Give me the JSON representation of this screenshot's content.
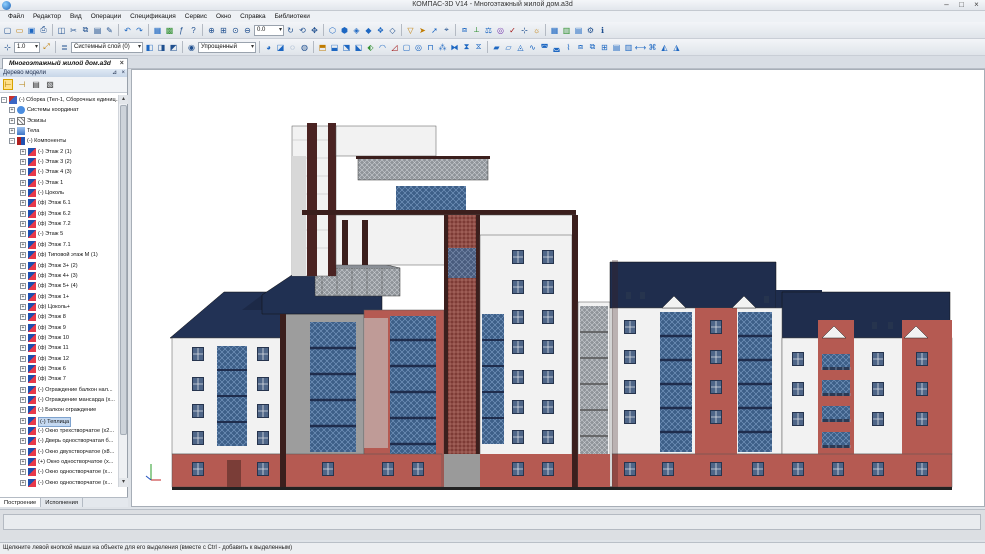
{
  "window": {
    "title": "КОМПАС-3D V14 - Многоэтажный жилой дом.a3d",
    "controls": [
      "minimize",
      "maximize",
      "close"
    ]
  },
  "menu": [
    "Файл",
    "Редактор",
    "Вид",
    "Операции",
    "Спецификация",
    "Сервис",
    "Окно",
    "Справка",
    "Библиотеки"
  ],
  "toolbar": {
    "scale_value": "0.0",
    "line_width": "1.0",
    "layer": "Системный слой (0)",
    "render_mode": "Упрощенный"
  },
  "document_tab": {
    "label": "Многоэтажный жилой дом.a3d"
  },
  "tree_panel": {
    "header": "Дерево модели",
    "root": "(-) Сборка (Тел-1, Сборочных единиц...",
    "items": [
      {
        "label": "Системы координат",
        "icon": "csys-icon",
        "level": 1
      },
      {
        "label": "Эскизы",
        "icon": "sketch-icon",
        "level": 1
      },
      {
        "label": "Тела",
        "icon": "body-icon",
        "level": 1
      },
      {
        "label": "(-) Компоненты",
        "icon": "components-icon",
        "level": 1
      },
      {
        "label": "(-) Этаж 2 (1)",
        "icon": "component-icon",
        "level": 2
      },
      {
        "label": "(-) Этаж 3 (2)",
        "icon": "component-icon",
        "level": 2
      },
      {
        "label": "(-) Этаж 4 (3)",
        "icon": "component-icon",
        "level": 2
      },
      {
        "label": "(-) Этаж 1",
        "icon": "component-icon",
        "level": 2
      },
      {
        "label": "(-) Цоколь",
        "icon": "component-icon",
        "level": 2
      },
      {
        "label": "(ф) Этаж 6.1",
        "icon": "component-icon",
        "level": 2
      },
      {
        "label": "(ф) Этаж 6.2",
        "icon": "component-icon",
        "level": 2
      },
      {
        "label": "(ф) Этаж 7.2",
        "icon": "component-icon",
        "level": 2
      },
      {
        "label": "(-) Этаж 5",
        "icon": "component-icon",
        "level": 2
      },
      {
        "label": "(ф) Этаж 7.1",
        "icon": "component-icon",
        "level": 2
      },
      {
        "label": "(ф) Типовой этаж М (1)",
        "icon": "component-icon",
        "level": 2
      },
      {
        "label": "(ф) Этаж 3+ (2)",
        "icon": "component-icon",
        "level": 2
      },
      {
        "label": "(ф) Этаж 4+ (3)",
        "icon": "component-icon",
        "level": 2
      },
      {
        "label": "(ф) Этаж 5+ (4)",
        "icon": "component-icon",
        "level": 2
      },
      {
        "label": "(ф) Этаж 1+",
        "icon": "component-icon",
        "level": 2
      },
      {
        "label": "(ф) Цоколь+",
        "icon": "component-icon",
        "level": 2
      },
      {
        "label": "(ф) Этаж 8",
        "icon": "component-icon",
        "level": 2
      },
      {
        "label": "(ф) Этаж 9",
        "icon": "component-icon",
        "level": 2
      },
      {
        "label": "(ф) Этаж 10",
        "icon": "component-icon",
        "level": 2
      },
      {
        "label": "(ф) Этаж 11",
        "icon": "component-icon",
        "level": 2
      },
      {
        "label": "(ф) Этаж 12",
        "icon": "component-icon",
        "level": 2
      },
      {
        "label": "(ф) Этаж 6",
        "icon": "component-icon",
        "level": 2
      },
      {
        "label": "(ф) Этаж 7",
        "icon": "component-icon",
        "level": 2
      },
      {
        "label": "(-) Ограждение балкон нал...",
        "icon": "component-icon",
        "level": 2
      },
      {
        "label": "(-) Ограждение мансарда (x...",
        "icon": "component-icon",
        "level": 2
      },
      {
        "label": "(-) Балкон ограждение",
        "icon": "component-icon",
        "level": 2
      },
      {
        "label": "(-) Теплица",
        "icon": "component-icon",
        "level": 2,
        "selected": true
      },
      {
        "label": "(-) Окно трехстворчатое (x2...",
        "icon": "component-icon",
        "level": 2
      },
      {
        "label": "(-) Дверь одностворчатая б...",
        "icon": "component-icon",
        "level": 2
      },
      {
        "label": "(-) Окно двухстворчатое (x8...",
        "icon": "component-icon",
        "level": 2
      },
      {
        "label": "(+) Окно одностворчатое (x...",
        "icon": "component-icon",
        "level": 2
      },
      {
        "label": "(-) Окно одностворчатое (x...",
        "icon": "component-icon",
        "level": 2
      },
      {
        "label": "(-) Окно одностворчатое (x...",
        "icon": "component-icon",
        "level": 2
      }
    ],
    "tabs": [
      "Построение",
      "Исполнения"
    ]
  },
  "status_hint": "Щелкните левой кнопкой мыши на объекте для его выделения (вместе с Ctrl - добавить к выделенным)",
  "colors": {
    "brick": "#b55a52",
    "roof": "#1f2d4d",
    "frame_dark": "#4a2322",
    "glass_blue": "#3b5f8a",
    "wall_white": "#f3f3f3",
    "wall_grey": "#9a9a9a"
  }
}
